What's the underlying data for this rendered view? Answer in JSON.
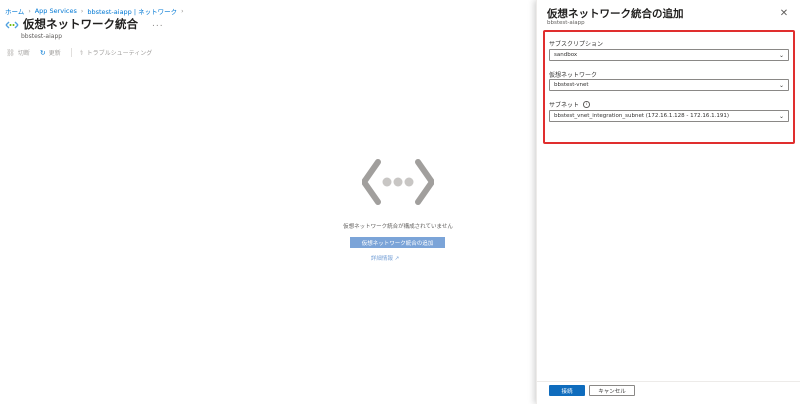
{
  "breadcrumb": {
    "items": [
      "ホーム",
      "App Services",
      "bbstest-aiapp | ネットワーク"
    ]
  },
  "header": {
    "title": "仮想ネットワーク統合",
    "subtitle": "bbstest-aiapp",
    "more": "..."
  },
  "toolbar": {
    "items": [
      {
        "label": "切断",
        "icon": "unlink-icon"
      },
      {
        "label": "更新",
        "icon": "refresh-icon"
      },
      {
        "label": "トラブルシューティング",
        "icon": "troubleshoot-icon"
      }
    ]
  },
  "empty_state": {
    "message": "仮想ネットワーク統合が構成されていません",
    "add_button": "仮想ネットワーク統合の追加",
    "learn_more": "詳細情報 ↗"
  },
  "panel": {
    "title": "仮想ネットワーク統合の追加",
    "subtitle": "bbstest-aiapp",
    "close": "✕",
    "subscription": {
      "label": "サブスクリプション",
      "value": "sandbox"
    },
    "vnet": {
      "label": "仮想ネットワーク",
      "value": "bbstest-vnet"
    },
    "subnet": {
      "label": "サブネット",
      "value": "bbstest_vnet_integration_subnet (172.16.1.128 - 172.16.1.191)"
    },
    "ok_button": "接続",
    "cancel_button": "キャンセル"
  },
  "colors": {
    "accent": "#0078d4",
    "highlight_border": "#e02e2e",
    "disabled_button": "#7ba4d8"
  }
}
